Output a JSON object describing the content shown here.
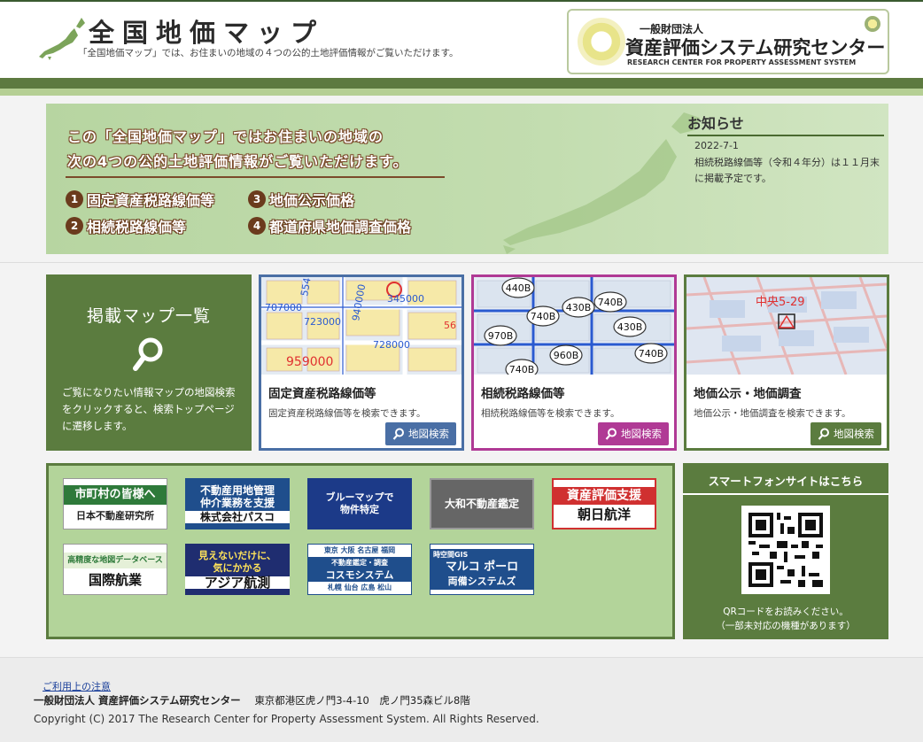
{
  "header": {
    "title": "全国地価マップ",
    "subtitle": "「全国地価マップ」では、お住まいの地域の４つの公的土地評価情報がご覧いただけます。",
    "org_small": "一般財団法人",
    "org_name": "資産評価システム研究センター",
    "org_en": "RESEARCH CENTER FOR PROPERTY ASSESSMENT SYSTEM"
  },
  "hero": {
    "line1": "この「全国地価マップ」ではお住まいの地域の",
    "line2": "次の4つの公的土地評価情報がご覧いただけます。",
    "items": [
      {
        "num": "1",
        "label": "固定資産税路線価等"
      },
      {
        "num": "2",
        "label": "相続税路線価等"
      },
      {
        "num": "3",
        "label": "地価公示価格"
      },
      {
        "num": "4",
        "label": "都道府県地価調査価格"
      }
    ]
  },
  "news": {
    "title": "お知らせ",
    "date": "2022-7-1",
    "body": "相続税路線価等（令和４年分）は１１月末に掲載予定です。"
  },
  "maplist": {
    "title": "掲載マップ一覧",
    "desc": "ご覧になりたい情報マップの地図検索をクリックすると、検索トップページに遷移します。"
  },
  "cards": [
    {
      "title": "固定資産税路線価等",
      "desc": "固定資産税路線価等を検索できます。",
      "button": "地図検索",
      "color": "#4a6fa5",
      "map_labels": [
        "554",
        "707000",
        "345000",
        "723000",
        "728000",
        "959000",
        "56",
        "940000"
      ]
    },
    {
      "title": "相続税路線価等",
      "desc": "相続税路線価等を検索できます。",
      "button": "地図検索",
      "color": "#b03a95",
      "map_labels": [
        "440B",
        "740B",
        "430B",
        "740B",
        "970B",
        "430B",
        "960B",
        "740B",
        "740B"
      ]
    },
    {
      "title": "地価公示・地価調査",
      "desc": "地価公示・地価調査を検索できます。",
      "button": "地図検索",
      "color": "#5b7c3f",
      "map_labels": [
        "中央5-29"
      ]
    }
  ],
  "links": {
    "banners": [
      {
        "line1": "市町村の皆様へ",
        "line2": "日本不動産研究所"
      },
      {
        "line1": "不動産用地管理",
        "line2": "仲介業務を支援",
        "line3": "株式会社パスコ"
      },
      {
        "line1": "ブルーマップで",
        "line2": "物件特定"
      },
      {
        "line1": "大和不動産鑑定"
      },
      {
        "line1": "資産評価支援",
        "line2": "朝日航洋"
      },
      {
        "line1": "高精度な地図データベース",
        "line2": "国際航業"
      },
      {
        "line1": "見えないだけに、",
        "line2": "気にかかる",
        "line3": "アジア航測"
      },
      {
        "line1": "東京 大阪 名古屋 福岡",
        "line2": "不動産鑑定・調査",
        "line3": "コスモシステム",
        "line4": "札幌 仙台 広島 松山"
      },
      {
        "line1": "時空間GIS",
        "line2": "マルコ ポーロ",
        "line3": "両備システムズ"
      }
    ]
  },
  "smartphone": {
    "title": "スマートフォンサイトはこちら",
    "note1": "QRコードをお読みください。",
    "note2": "（一部未対応の機種があります）"
  },
  "footer": {
    "link": "ご利用上の注意",
    "org": "一般財団法人 資産評価システム研究センター",
    "address": "東京都港区虎ノ門3-4-10　虎ノ門35森ビル8階",
    "copyright": "Copyright (C) 2017 The Research Center for Property Assessment System. All Rights Reserved."
  }
}
